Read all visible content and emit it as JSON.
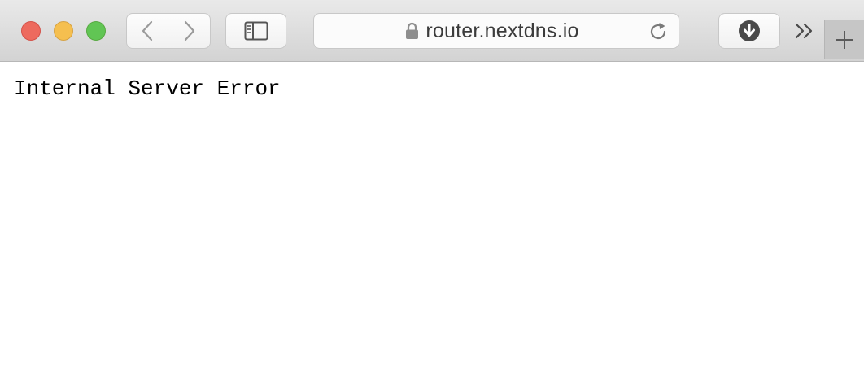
{
  "browser": {
    "address_bar": {
      "url": "router.nextdns.io",
      "secure": true
    },
    "icons": {
      "back": "chevron-left-icon",
      "forward": "chevron-right-icon",
      "sidebar": "sidebar-icon",
      "lock": "lock-icon",
      "reload": "reload-icon",
      "download": "download-icon",
      "overflow": "double-chevron-right-icon",
      "new_tab": "plus-icon"
    },
    "colors": {
      "close": "#ed6a5e",
      "minimize": "#f5bf4f",
      "zoom": "#61c554"
    }
  },
  "page": {
    "body_text": "Internal Server Error"
  }
}
